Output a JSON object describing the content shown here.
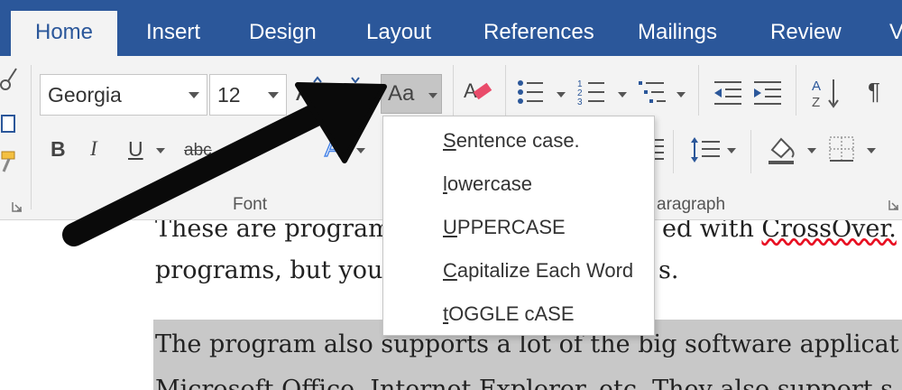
{
  "tabs": [
    {
      "label": "Home",
      "active": true
    },
    {
      "label": "Insert"
    },
    {
      "label": "Design"
    },
    {
      "label": "Layout"
    },
    {
      "label": "References"
    },
    {
      "label": "Mailings"
    },
    {
      "label": "Review"
    },
    {
      "label": "V"
    }
  ],
  "font": {
    "name": "Georgia",
    "size": "12",
    "group_label": "Font",
    "bold": "B",
    "italic": "I",
    "underline": "U",
    "strike": "abc",
    "subscript": "x",
    "change_case": "Aa",
    "grow": "A",
    "shrink": "A",
    "text_effects": "A"
  },
  "paragraph": {
    "group_label": "aragraph",
    "sort": "AZ",
    "pilcrow": "¶"
  },
  "change_case_menu": {
    "items": [
      {
        "first": "S",
        "rest": "entence case."
      },
      {
        "first": "l",
        "rest": "owercase"
      },
      {
        "first": "U",
        "rest": "PPERCASE"
      },
      {
        "first": "C",
        "rest": "apitalize Each Word"
      },
      {
        "first": "t",
        "rest": "OGGLE cASE"
      }
    ]
  },
  "document": {
    "line1_left": "These are program",
    "line1_right": "ed with ",
    "line1_word": "CrossOver.",
    "line2_left": "programs, but you",
    "line2_right": "s.",
    "line3": "The program also supports a lot of the big software applicat",
    "line4": "Microsoft Office, Internet Explorer, etc. They also support s"
  },
  "colors": {
    "ribbon_blue": "#2b579a",
    "ribbon_bg": "#f3f3f3",
    "highlight": "#c8c8c8"
  }
}
